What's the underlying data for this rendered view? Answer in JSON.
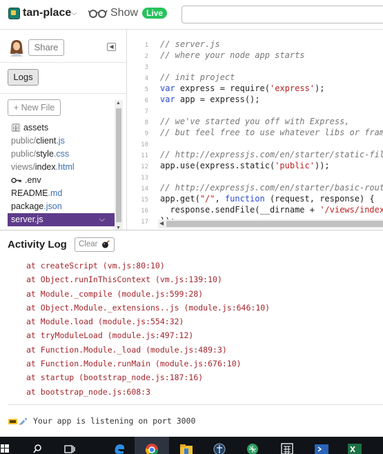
{
  "header": {
    "project_name": "tan-place",
    "show_label": "Show",
    "live_badge": "Live",
    "search_value": ""
  },
  "sidebar": {
    "share_label": "Share",
    "logs_label": "Logs",
    "new_file_label": "+ New File",
    "files": [
      {
        "prefix": "",
        "name": "assets",
        "ext": "",
        "icon": "folder-icon"
      },
      {
        "prefix": "public/",
        "name": "client",
        "ext": ".js",
        "icon": ""
      },
      {
        "prefix": "public/",
        "name": "style",
        "ext": ".css",
        "icon": ""
      },
      {
        "prefix": "views/",
        "name": "index",
        "ext": ".html",
        "icon": ""
      },
      {
        "prefix": "",
        "name": ".env",
        "ext": "",
        "icon": "key-icon"
      },
      {
        "prefix": "",
        "name": "README",
        "ext": ".md",
        "icon": ""
      },
      {
        "prefix": "",
        "name": "package",
        "ext": ".json",
        "icon": ""
      },
      {
        "prefix": "",
        "name": "server.js",
        "ext": "",
        "icon": "",
        "active": true
      }
    ]
  },
  "editor": {
    "lines": [
      {
        "n": "1",
        "t": "// server.js"
      },
      {
        "n": "2",
        "t": "// where your node app starts"
      },
      {
        "n": "3",
        "t": ""
      },
      {
        "n": "4",
        "t": "// init project"
      },
      {
        "n": "5",
        "t": "var express = require('express');"
      },
      {
        "n": "6",
        "t": "var app = express();"
      },
      {
        "n": "7",
        "t": ""
      },
      {
        "n": "8",
        "t": "// we've started you off with Express,"
      },
      {
        "n": "9",
        "t": "// but feel free to use whatever libs or fram"
      },
      {
        "n": "10",
        "t": ""
      },
      {
        "n": "11",
        "t": "// http://expressjs.com/en/starter/static-fil"
      },
      {
        "n": "12",
        "t": "app.use(express.static('public'));"
      },
      {
        "n": "13",
        "t": ""
      },
      {
        "n": "14",
        "t": "// http://expressjs.com/en/starter/basic-rout"
      },
      {
        "n": "15",
        "t": "app.get(\"/\", function (request, response) {"
      },
      {
        "n": "16",
        "t": "  response.sendFile(__dirname + '/views/index"
      },
      {
        "n": "17",
        "t": "});"
      }
    ]
  },
  "activity_log": {
    "title": "Activity Log",
    "clear_label": "Clear",
    "lines": [
      "at createScript (vm.js:80:10)",
      "at Object.runInThisContext (vm.js:139:10)",
      "at Module._compile (module.js:599:28)",
      "at Object.Module._extensions..js (module.js:646:10)",
      "at Module.load (module.js:554:32)",
      "at tryModuleLoad (module.js:497:12)",
      "at Function.Module._load (module.js:489:3)",
      "at Function.Module.runMain (module.js:676:10)",
      "at startup (bootstrap_node.js:187:16)",
      "at bootstrap_node.js:608:3"
    ],
    "listening": "Your app is listening on port 3000"
  },
  "colors": {
    "accent_purple": "#5e3b8a",
    "live_green": "#27c35c",
    "log_red": "#a3242b",
    "keyword_blue": "#2a4bd7",
    "string_red": "#b22222"
  },
  "taskbar": {
    "icons": [
      "windows-icon",
      "search-icon",
      "task-view-icon",
      "edge-icon",
      "chrome-icon",
      "file-explorer-icon",
      "app-icon",
      "app-icon-2",
      "calculator-icon",
      "powershell-icon",
      "excel-icon"
    ]
  }
}
